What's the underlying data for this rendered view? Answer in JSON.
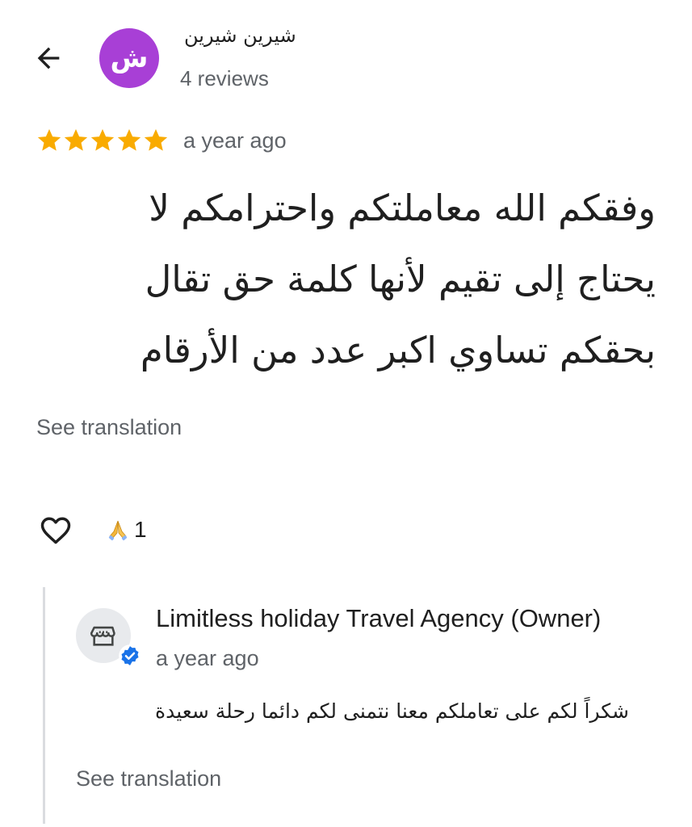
{
  "header": {
    "back_icon": "arrow-left-icon",
    "avatar_initials": "ش",
    "avatar_color": "#a83fd6",
    "reviewer_name": "شيرين شيرين",
    "reviewer_meta": "4 reviews"
  },
  "review": {
    "rating": 5,
    "max_rating": 5,
    "star_color": "#f9ab00",
    "date": "a year ago",
    "text": "وفقكم الله معاملتكم واحترامكم لا يحتاج إلى تقيم لأنها كلمة حق تقال بحقكم تساوي اكبر عدد من الأرقام",
    "see_translation": "See translation"
  },
  "reactions": {
    "like_icon": "heart-outline-icon",
    "emoji_icon": "folded-hands-emoji-icon",
    "count": "1"
  },
  "owner_reply": {
    "avatar_icon": "storefront-icon",
    "verified_icon": "verified-badge-icon",
    "verified_color": "#1a73e8",
    "name": "Limitless holiday Travel Agency (Owner)",
    "date": "a year ago",
    "text": "شكراً لكم على تعاملكم معنا نتمنى لكم دائما رحلة سعيدة",
    "see_translation": "See translation"
  }
}
